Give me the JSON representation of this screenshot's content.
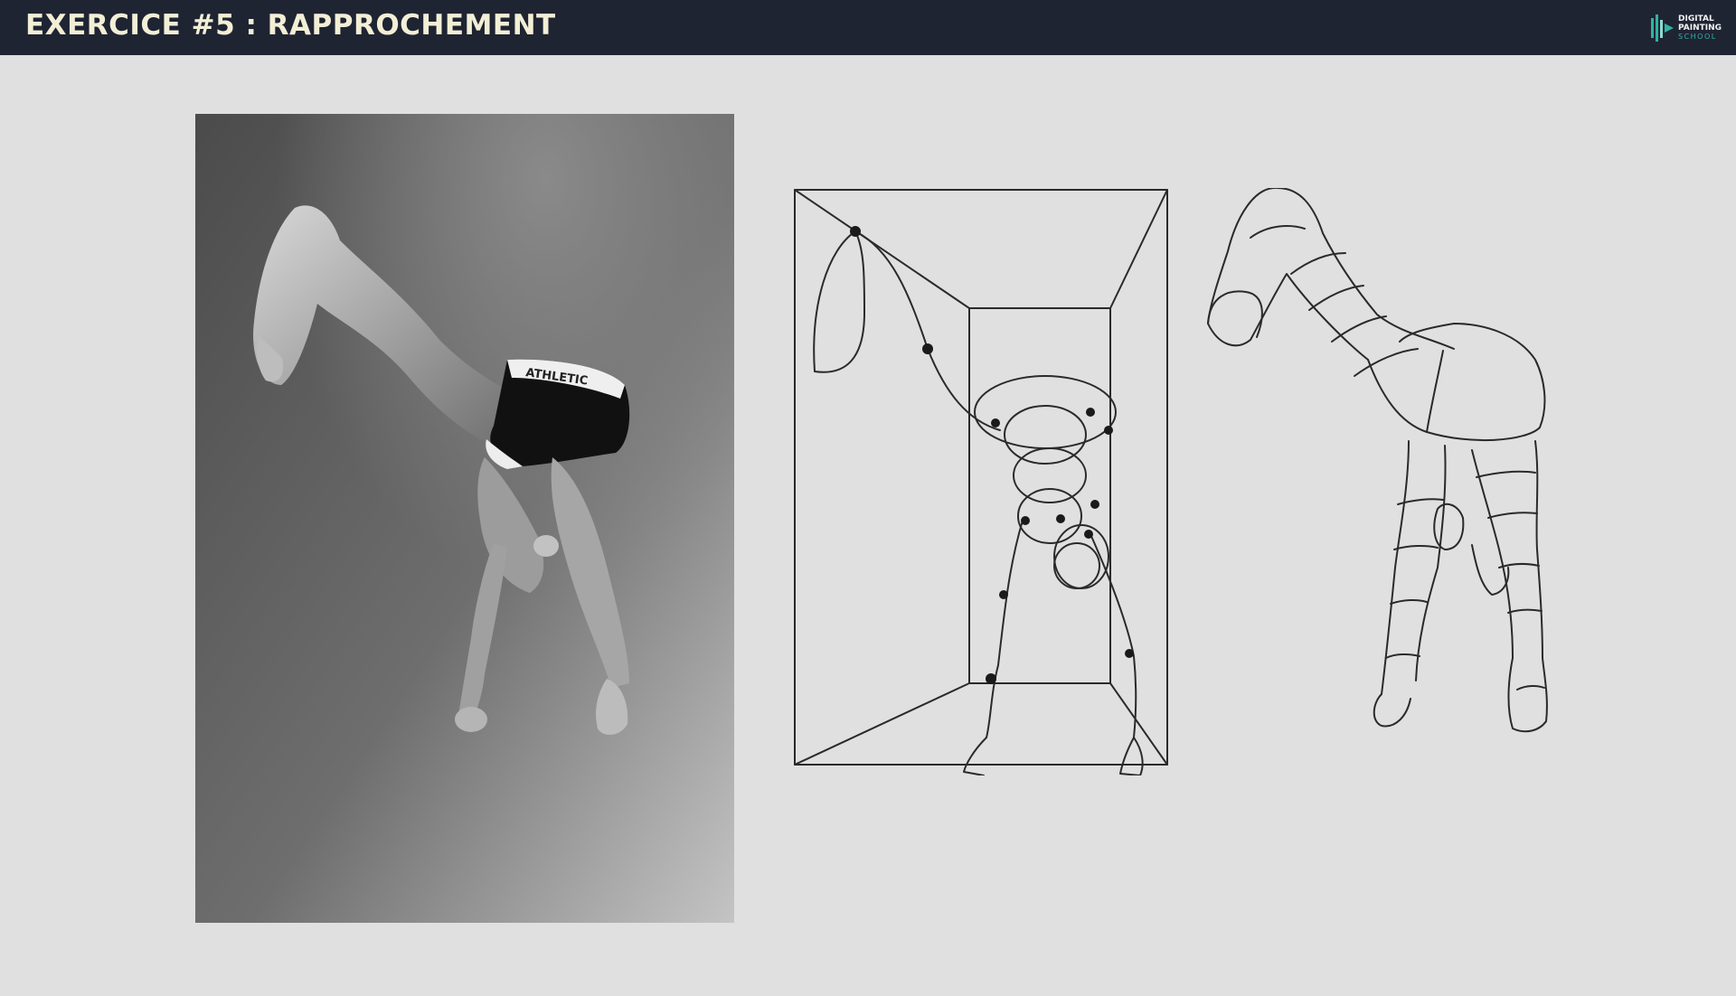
{
  "header": {
    "title": "EXERCICE #5 : RAPPROCHEMENT",
    "background_color": "#1f2433",
    "title_color": "#f3efd6"
  },
  "logo": {
    "line1": "DIGITAL",
    "line2": "PAINTING",
    "line3": "SCHOOL",
    "accent_color": "#2fb3a3"
  },
  "canvas": {
    "background_color": "#e0e0e0"
  },
  "panels": {
    "photo": {
      "icon": "reference-photo-athlete"
    },
    "box_sketch": {
      "icon": "perspective-box-gesture-sketch"
    },
    "form_sketch": {
      "icon": "volumetric-form-sketch"
    }
  }
}
